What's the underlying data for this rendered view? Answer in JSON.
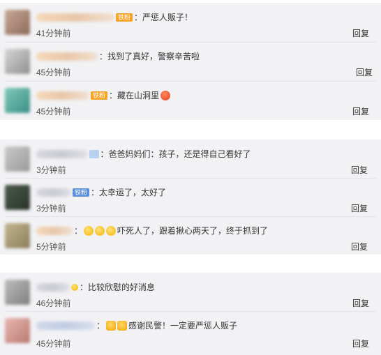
{
  "groups": [
    {
      "comments": [
        {
          "badge": "铁粉",
          "text": "：严惩人贩子！",
          "time": "41分钟前",
          "reply": "回复"
        },
        {
          "text": "：找到了真好，警察辛苦啦",
          "time": "45分钟前",
          "reply": "回复"
        },
        {
          "badge": "铁粉",
          "text": "：藏在山洞里",
          "time": "45分钟前",
          "reply": "回复"
        }
      ]
    },
    {
      "comments": [
        {
          "text": "：爸爸妈妈们：孩子，还是得自己看好了",
          "time": "3分钟前",
          "reply": "回复"
        },
        {
          "badge": "铁粉",
          "text": "：太幸运了，太好了",
          "time": "3分钟前",
          "reply": "回复"
        },
        {
          "text": "吓死人了，跟着揪心两天了，终于抓到了",
          "time": "5分钟前",
          "reply": "回复"
        }
      ]
    },
    {
      "comments": [
        {
          "text": "：比较欣慰的好消息",
          "time": "46分钟前",
          "reply": "回复"
        },
        {
          "text": "感谢民警！一定要严惩人贩子",
          "time": "45分钟前",
          "reply": "回复"
        }
      ]
    }
  ]
}
